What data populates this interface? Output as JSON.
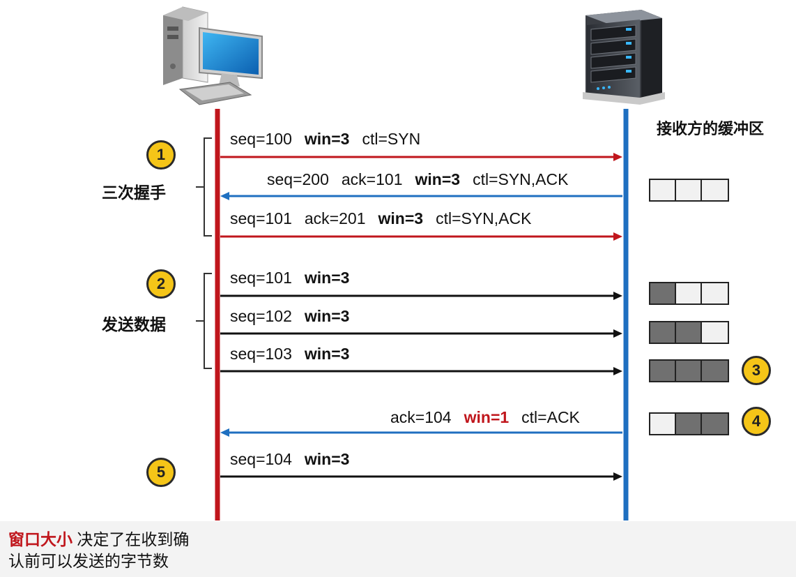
{
  "buffer_title": "接收方的缓冲区",
  "groups": {
    "handshake": "三次握手",
    "send_data": "发送数据"
  },
  "markers": [
    "1",
    "2",
    "3",
    "4",
    "5"
  ],
  "messages": [
    {
      "direction": "right",
      "color": "#c0161c",
      "parts": [
        {
          "text": "seq=100"
        },
        {
          "text": "win=3",
          "bold": true
        },
        {
          "text": "ctl=SYN"
        }
      ]
    },
    {
      "direction": "left",
      "color": "#1f6fc0",
      "parts": [
        {
          "text": "seq=200"
        },
        {
          "text": "ack=101"
        },
        {
          "text": "win=3",
          "bold": true
        },
        {
          "text": "ctl=SYN,ACK"
        }
      ]
    },
    {
      "direction": "right",
      "color": "#c0161c",
      "parts": [
        {
          "text": "seq=101"
        },
        {
          "text": "ack=201"
        },
        {
          "text": "win=3",
          "bold": true
        },
        {
          "text": "ctl=SYN,ACK"
        }
      ]
    },
    {
      "direction": "right",
      "color": "#111111",
      "parts": [
        {
          "text": "seq=101"
        },
        {
          "text": "win=3",
          "bold": true
        }
      ]
    },
    {
      "direction": "right",
      "color": "#111111",
      "parts": [
        {
          "text": "seq=102"
        },
        {
          "text": "win=3",
          "bold": true
        }
      ]
    },
    {
      "direction": "right",
      "color": "#111111",
      "parts": [
        {
          "text": "seq=103"
        },
        {
          "text": "win=3",
          "bold": true
        }
      ]
    },
    {
      "direction": "left",
      "color": "#1f6fc0",
      "parts": [
        {
          "text": "ack=104"
        },
        {
          "text": "win=1",
          "bold": true,
          "red": true
        },
        {
          "text": "ctl=ACK"
        }
      ]
    },
    {
      "direction": "right",
      "color": "#111111",
      "parts": [
        {
          "text": "seq=104"
        },
        {
          "text": "win=3",
          "bold": true
        }
      ]
    }
  ],
  "buffers": [
    [
      0,
      0,
      0
    ],
    [
      1,
      0,
      0
    ],
    [
      1,
      1,
      0
    ],
    [
      1,
      1,
      1
    ],
    [
      0,
      1,
      1
    ]
  ],
  "footer": {
    "highlight": "窗口大小",
    "line1_rest": "决定了在收到确",
    "line2": "认前可以发送的字节数"
  },
  "colors": {
    "client_line": "#c0161c",
    "server_line": "#1f6fc0",
    "marker": "#f5c518",
    "buffer_filled": "#707070",
    "buffer_empty": "#f1f1f1"
  },
  "icons": {
    "client": "desktop-computer-icon",
    "server": "server-rack-icon"
  }
}
